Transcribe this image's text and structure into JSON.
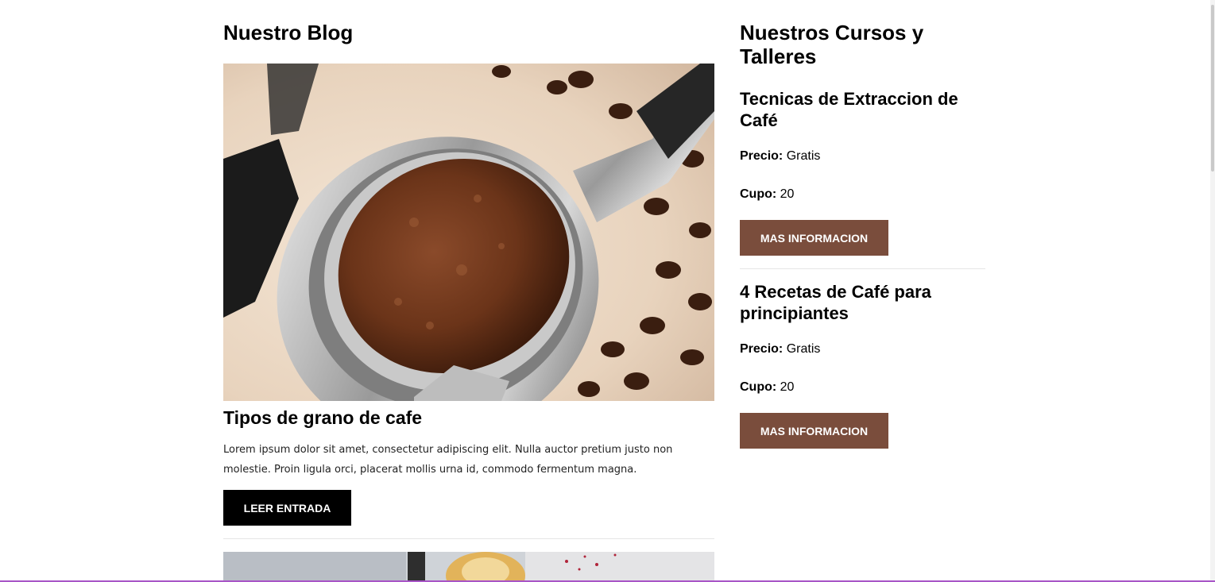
{
  "blog": {
    "heading": "Nuestro Blog",
    "post": {
      "image_alt": "portafiltro con café molido",
      "title": "Tipos de grano de cafe",
      "excerpt": "Lorem ipsum dolor sit amet, consectetur adipiscing elit. Nulla auctor pretium justo non molestie. Proin ligula orci, placerat mollis urna id, commodo fermentum magna.",
      "button_label": "LEER ENTRADA"
    }
  },
  "courses": {
    "heading": "Nuestros Cursos y Talleres",
    "price_label": "Precio:",
    "capacity_label": "Cupo:",
    "items": [
      {
        "title": "Tecnicas de Extraccion de Café",
        "price": "Gratis",
        "capacity": "20",
        "button_label": "MAS INFORMACION"
      },
      {
        "title": "4 Recetas de Café para principiantes",
        "price": "Gratis",
        "capacity": "20",
        "button_label": "MAS INFORMACION"
      }
    ]
  },
  "colors": {
    "accent": "#7a4d3c",
    "primary_button": "#000000",
    "text": "#000000"
  }
}
